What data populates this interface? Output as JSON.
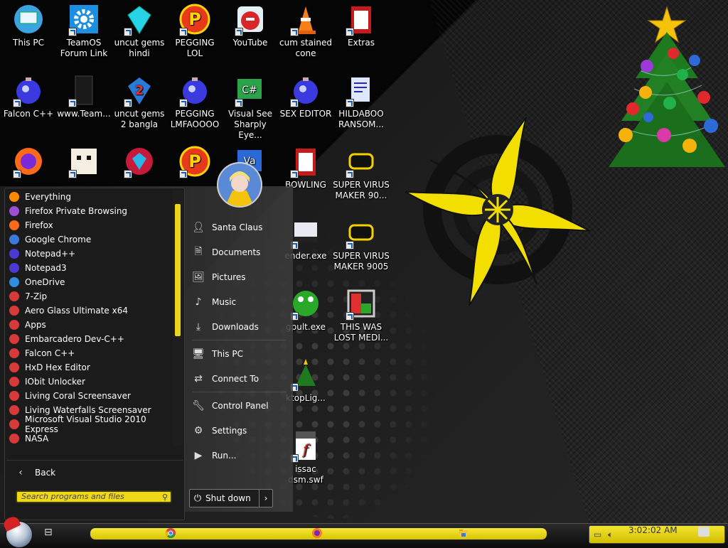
{
  "desktop": {
    "icons": [
      {
        "label": "This PC",
        "icon": "monitor-icon"
      },
      {
        "label": "TeamOS Forum Link",
        "icon": "gear-icon"
      },
      {
        "label": "uncut gems hindi",
        "icon": "gem-icon"
      },
      {
        "label": "PEGGING LOL",
        "icon": "p-badge-icon"
      },
      {
        "label": "YouTube",
        "icon": "angry-bird-icon"
      },
      {
        "label": "cum stained cone",
        "icon": "traffic-cone-icon"
      },
      {
        "label": "Extras",
        "icon": "red-box-icon"
      },
      {
        "label": "Falcon C++",
        "icon": "ornament-icon"
      },
      {
        "label": "www.Team...",
        "icon": "book-icon"
      },
      {
        "label": "uncut gems 2 bangla",
        "icon": "gem-two-icon"
      },
      {
        "label": "PEGGING LMFAOOOO",
        "icon": "ornament-icon"
      },
      {
        "label": "Visual See Sharply Eye...",
        "icon": "csharp-icon"
      },
      {
        "label": "SEX EDITOR",
        "icon": "ornament-icon"
      },
      {
        "label": "HILDABOO RANSOM...",
        "icon": "script-icon"
      },
      {
        "label": "",
        "icon": "firefox-icon"
      },
      {
        "label": "",
        "icon": "pixel-cat-icon"
      },
      {
        "label": "",
        "icon": "gem-ring-icon"
      },
      {
        "label": "",
        "icon": "p-badge-icon"
      },
      {
        "label": "",
        "icon": "vs-icon"
      },
      {
        "label": "BOWLING",
        "icon": "red-box-icon"
      },
      {
        "label": "SUPER VIRUS MAKER 90...",
        "icon": "gold-binoculars-icon"
      },
      {
        "label": "ender.exe",
        "icon": "film-icon"
      },
      {
        "label": "SUPER VIRUS MAKER 9005",
        "icon": "gold-binoculars-icon"
      },
      {
        "label": "gpult.exe",
        "icon": "frog-icon"
      },
      {
        "label": "THIS WAS LOST MEDI...",
        "icon": "tile-icon"
      },
      {
        "label": "ktopLig...",
        "icon": "tree-icon"
      },
      {
        "label": "issac dsm.swf",
        "icon": "swf-icon"
      }
    ]
  },
  "start_menu": {
    "programs": [
      {
        "label": "Everything",
        "color": "#ff8a00"
      },
      {
        "label": "Firefox Private Browsing",
        "color": "#9b4fd3"
      },
      {
        "label": "Firefox",
        "color": "#ff6a1a"
      },
      {
        "label": "Google Chrome",
        "color": "#3a7ad8"
      },
      {
        "label": "Notepad++",
        "color": "#4a3ad3"
      },
      {
        "label": "Notepad3",
        "color": "#4a3ad3"
      },
      {
        "label": "OneDrive",
        "color": "#2f8ce0"
      },
      {
        "label": "7-Zip",
        "color": "#d83a3a"
      },
      {
        "label": "Aero Glass Ultimate x64",
        "color": "#d83a3a"
      },
      {
        "label": "Apps",
        "color": "#d83a3a"
      },
      {
        "label": "Embarcadero Dev-C++",
        "color": "#d83a3a"
      },
      {
        "label": "Falcon C++",
        "color": "#d83a3a"
      },
      {
        "label": "HxD Hex Editor",
        "color": "#d83a3a"
      },
      {
        "label": "IObit Unlocker",
        "color": "#d83a3a"
      },
      {
        "label": "Living Coral Screensaver",
        "color": "#d83a3a"
      },
      {
        "label": "Living Waterfalls Screensaver",
        "color": "#d83a3a"
      },
      {
        "label": "Microsoft Visual Studio 2010 Express",
        "color": "#d83a3a"
      },
      {
        "label": "NASA",
        "color": "#d83a3a"
      }
    ],
    "back_label": "Back",
    "search_placeholder": "Search programs and files",
    "right_items": [
      {
        "label": "Santa Claus",
        "icon": "user-icon"
      },
      {
        "label": "Documents",
        "icon": "document-icon"
      },
      {
        "label": "Pictures",
        "icon": "picture-icon"
      },
      {
        "label": "Music",
        "icon": "music-icon"
      },
      {
        "label": "Downloads",
        "icon": "download-icon"
      },
      {
        "label": "This PC",
        "icon": "computer-icon"
      },
      {
        "label": "Connect To",
        "icon": "connect-icon"
      },
      {
        "label": "Control Panel",
        "icon": "wrench-icon"
      },
      {
        "label": "Settings",
        "icon": "gear-icon"
      },
      {
        "label": "Run...",
        "icon": "run-icon"
      }
    ],
    "shutdown_label": "Shut down"
  },
  "taskbar": {
    "clock": "3:02:02 AM",
    "pinned": [
      "chrome-icon",
      "firefox-icon",
      "file-explorer-icon"
    ]
  }
}
